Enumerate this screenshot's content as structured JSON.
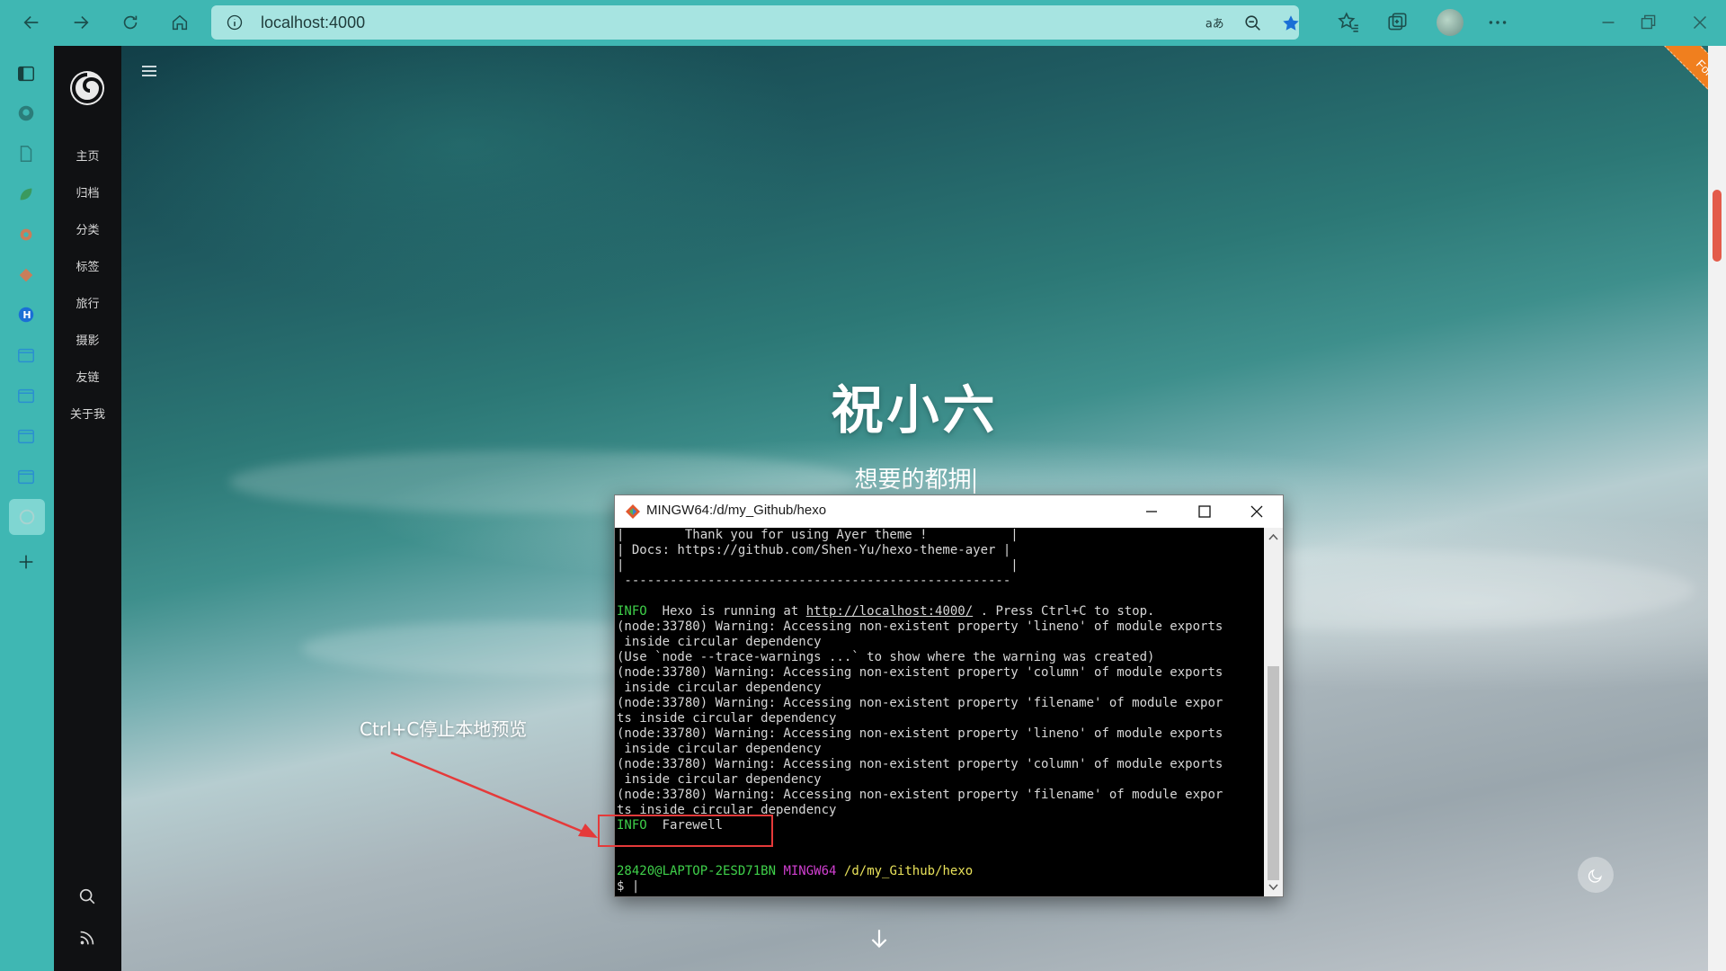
{
  "browser": {
    "url": "localhost:4000"
  },
  "site": {
    "menu": [
      "主页",
      "归档",
      "分类",
      "标签",
      "旅行",
      "摄影",
      "友链",
      "关于我"
    ],
    "title": "祝小六",
    "subtitle": "想要的都拥",
    "ribbon": "Fork me on GitHub"
  },
  "annotation": {
    "text": "Ctrl+C停止本地预览"
  },
  "terminal": {
    "title": "MINGW64:/d/my_Github/hexo",
    "lines": [
      {
        "parts": [
          {
            "t": "|        Thank you for using Ayer theme !           |",
            "c": ""
          }
        ]
      },
      {
        "parts": [
          {
            "t": "| Docs: https://github.com/Shen-Yu/hexo-theme-ayer |",
            "c": ""
          }
        ]
      },
      {
        "parts": [
          {
            "t": "|                                                   |",
            "c": ""
          }
        ]
      },
      {
        "parts": [
          {
            "t": " ---------------------------------------------------",
            "c": ""
          }
        ]
      },
      {
        "parts": [
          {
            "t": "",
            "c": ""
          }
        ]
      },
      {
        "parts": [
          {
            "t": "INFO",
            "c": "green"
          },
          {
            "t": "  Hexo is running at ",
            "c": ""
          },
          {
            "t": "http://localhost:4000/",
            "c": "ul"
          },
          {
            "t": " . Press Ctrl+C to stop.",
            "c": ""
          }
        ]
      },
      {
        "parts": [
          {
            "t": "(node:33780) Warning: Accessing non-existent property 'lineno' of module exports",
            "c": ""
          }
        ]
      },
      {
        "parts": [
          {
            "t": " inside circular dependency",
            "c": ""
          }
        ]
      },
      {
        "parts": [
          {
            "t": "(Use `node --trace-warnings ...` to show where the warning was created)",
            "c": ""
          }
        ]
      },
      {
        "parts": [
          {
            "t": "(node:33780) Warning: Accessing non-existent property 'column' of module exports",
            "c": ""
          }
        ]
      },
      {
        "parts": [
          {
            "t": " inside circular dependency",
            "c": ""
          }
        ]
      },
      {
        "parts": [
          {
            "t": "(node:33780) Warning: Accessing non-existent property 'filename' of module expor",
            "c": ""
          }
        ]
      },
      {
        "parts": [
          {
            "t": "ts inside circular dependency",
            "c": ""
          }
        ]
      },
      {
        "parts": [
          {
            "t": "(node:33780) Warning: Accessing non-existent property 'lineno' of module exports",
            "c": ""
          }
        ]
      },
      {
        "parts": [
          {
            "t": " inside circular dependency",
            "c": ""
          }
        ]
      },
      {
        "parts": [
          {
            "t": "(node:33780) Warning: Accessing non-existent property 'column' of module exports",
            "c": ""
          }
        ]
      },
      {
        "parts": [
          {
            "t": " inside circular dependency",
            "c": ""
          }
        ]
      },
      {
        "parts": [
          {
            "t": "(node:33780) Warning: Accessing non-existent property 'filename' of module expor",
            "c": ""
          }
        ]
      },
      {
        "parts": [
          {
            "t": "ts inside circular dependency",
            "c": ""
          }
        ]
      },
      {
        "parts": [
          {
            "t": "INFO",
            "c": "green"
          },
          {
            "t": "  Farewell",
            "c": ""
          }
        ]
      },
      {
        "parts": [
          {
            "t": "",
            "c": ""
          }
        ]
      },
      {
        "parts": [
          {
            "t": "",
            "c": ""
          }
        ]
      },
      {
        "parts": [
          {
            "t": "28420@LAPTOP-2ESD71BN",
            "c": "green"
          },
          {
            "t": " ",
            "c": ""
          },
          {
            "t": "MINGW64",
            "c": "magenta"
          },
          {
            "t": " ",
            "c": ""
          },
          {
            "t": "/d/my_Github/hexo",
            "c": "yellow"
          }
        ]
      },
      {
        "parts": [
          {
            "t": "$ ",
            "c": ""
          },
          {
            "t": "|",
            "c": ""
          }
        ]
      }
    ]
  },
  "colors": {
    "chrome": "#3fb7b3",
    "sidebar": "#101113",
    "annotation": "#e53a3a",
    "ribbon": "#f07f1e"
  }
}
